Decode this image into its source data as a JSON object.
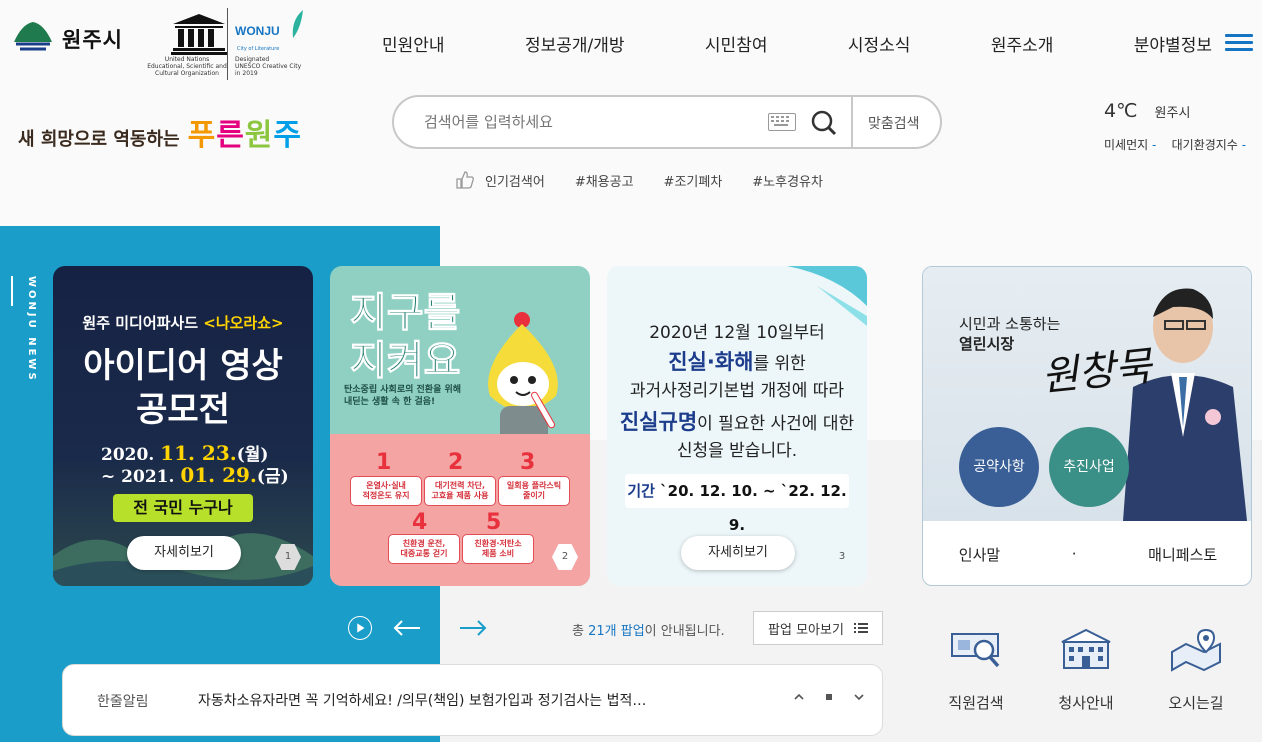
{
  "header": {
    "logo_text": "원주시",
    "unesco": {
      "un_text": "United Nations\nEducational, Scientific and\nCultural Organization",
      "wonju": "WONJU",
      "city_lit": "City of Literature",
      "designated": "Designated\nUNESCO Creative City\nin 2019"
    },
    "nav": [
      "민원안내",
      "정보공개/개방",
      "시민참여",
      "시정소식",
      "원주소개",
      "분야별정보"
    ],
    "slogan_small": "새 희망으로 역동하는",
    "slogan_big": [
      "푸",
      "른",
      "원",
      "주"
    ]
  },
  "search": {
    "placeholder": "검색어를 입력하세요",
    "custom_label": "맞춤검색",
    "popular_label": "인기검색어",
    "popular_tags": [
      "#채용공고",
      "#조기폐차",
      "#노후경유차"
    ]
  },
  "weather": {
    "temp": "4℃",
    "city": "원주시",
    "dust_label": "미세먼지",
    "dust_value": "-",
    "air_label": "대기환경지수",
    "air_value": "-"
  },
  "news": {
    "vertical_label": "WONJU NEWS",
    "cards": [
      {
        "subtitle_pre": "원주 미디어파사드 ",
        "subtitle_em": "<나오라쇼>",
        "title_l1": "아이디어 영상",
        "title_l2": "공모전",
        "date1_pre": "2020. ",
        "date1_em": "11. 23.",
        "date1_post": "(월)",
        "date2_pre": "~ 2021. ",
        "date2_em": "01. 29.",
        "date2_post": "(금)",
        "tag": "전 국민 누구나",
        "button": "자세히보기",
        "page": "1"
      },
      {
        "title_l1": "지구를",
        "title_l2": "지켜요",
        "sub1": "탄소중립 사회로의 전환을 위해",
        "sub2": "내딛는 생활 속 한 걸음!",
        "items": [
          {
            "num": "1",
            "text": "온열사·실내\n적정온도 유지"
          },
          {
            "num": "2",
            "text": "대기전력 차단,\n고효율 제품 사용"
          },
          {
            "num": "3",
            "text": "일회용 플라스틱\n줄이기"
          },
          {
            "num": "4",
            "text": "친환경 운전,\n대중교통 걷기"
          },
          {
            "num": "5",
            "text": "친환경·저탄소\n제품 소비"
          }
        ],
        "page": "2"
      },
      {
        "l1": "2020년 12월 10일부터",
        "l2_em": "진실·화해",
        "l2_post": "를 위한",
        "l3": "과거사정리기본법 개정에 따라",
        "l4_em": "진실규명",
        "l4_post": "이 필요한 사건에 대한",
        "l5": "신청을 받습니다.",
        "period_label": "기간",
        "period_value": " `20. 12. 10. ~ `22. 12. 9.",
        "button": "자세히보기",
        "page": "3"
      }
    ],
    "total_pre": "총 ",
    "total_em": "21개 팝업",
    "total_post": "이 안내됩니다.",
    "popup_btn": "팝업 모아보기"
  },
  "notice": {
    "label": "한줄알림",
    "text": "자동차소유자라면 꼭 기억하세요! /의무(책임) 보험가입과 정기검사는 법적…"
  },
  "mayor": {
    "line1": "시민과 소통하는",
    "line2": "열린시장",
    "signature": "원창묵",
    "pledge": "공약사항",
    "project": "추진사업",
    "greeting": "인사말",
    "dot": "·",
    "manifesto": "매니페스토"
  },
  "quick_links": [
    "직원검색",
    "청사안내",
    "오시는길"
  ],
  "colors": {
    "accent": "#1675c2",
    "news_bg": "#1a9ec9"
  }
}
